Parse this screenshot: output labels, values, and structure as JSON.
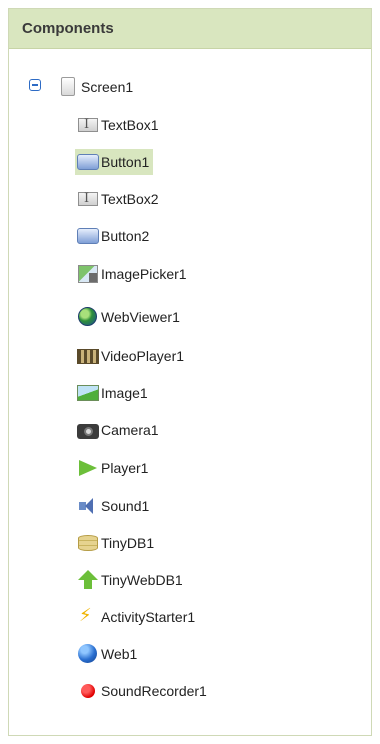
{
  "panel": {
    "title": "Components"
  },
  "tree": {
    "root": {
      "label": "Screen1",
      "icon": "screen-icon",
      "expanded": true
    },
    "children": [
      {
        "label": "TextBox1",
        "icon": "textbox-icon",
        "selected": false
      },
      {
        "label": "Button1",
        "icon": "button-icon",
        "selected": true
      },
      {
        "label": "TextBox2",
        "icon": "textbox-icon",
        "selected": false
      },
      {
        "label": "Button2",
        "icon": "button-icon",
        "selected": false
      },
      {
        "label": "ImagePicker1",
        "icon": "imagepicker-icon",
        "selected": false
      },
      {
        "label": "WebViewer1",
        "icon": "globe-icon",
        "selected": false
      },
      {
        "label": "VideoPlayer1",
        "icon": "videoplayer-icon",
        "selected": false
      },
      {
        "label": "Image1",
        "icon": "image-icon",
        "selected": false
      },
      {
        "label": "Camera1",
        "icon": "camera-icon",
        "selected": false
      },
      {
        "label": "Player1",
        "icon": "play-icon",
        "selected": false
      },
      {
        "label": "Sound1",
        "icon": "speaker-icon",
        "selected": false
      },
      {
        "label": "TinyDB1",
        "icon": "database-icon",
        "selected": false
      },
      {
        "label": "TinyWebDB1",
        "icon": "upload-arrow-icon",
        "selected": false
      },
      {
        "label": "ActivityStarter1",
        "icon": "lightning-icon",
        "selected": false
      },
      {
        "label": "Web1",
        "icon": "web-icon",
        "selected": false
      },
      {
        "label": "SoundRecorder1",
        "icon": "record-icon",
        "selected": false
      }
    ]
  },
  "colors": {
    "header_bg": "#d9e6bf",
    "selection_bg": "#d8e6bf",
    "toggle_blue": "#2d6bc5"
  }
}
